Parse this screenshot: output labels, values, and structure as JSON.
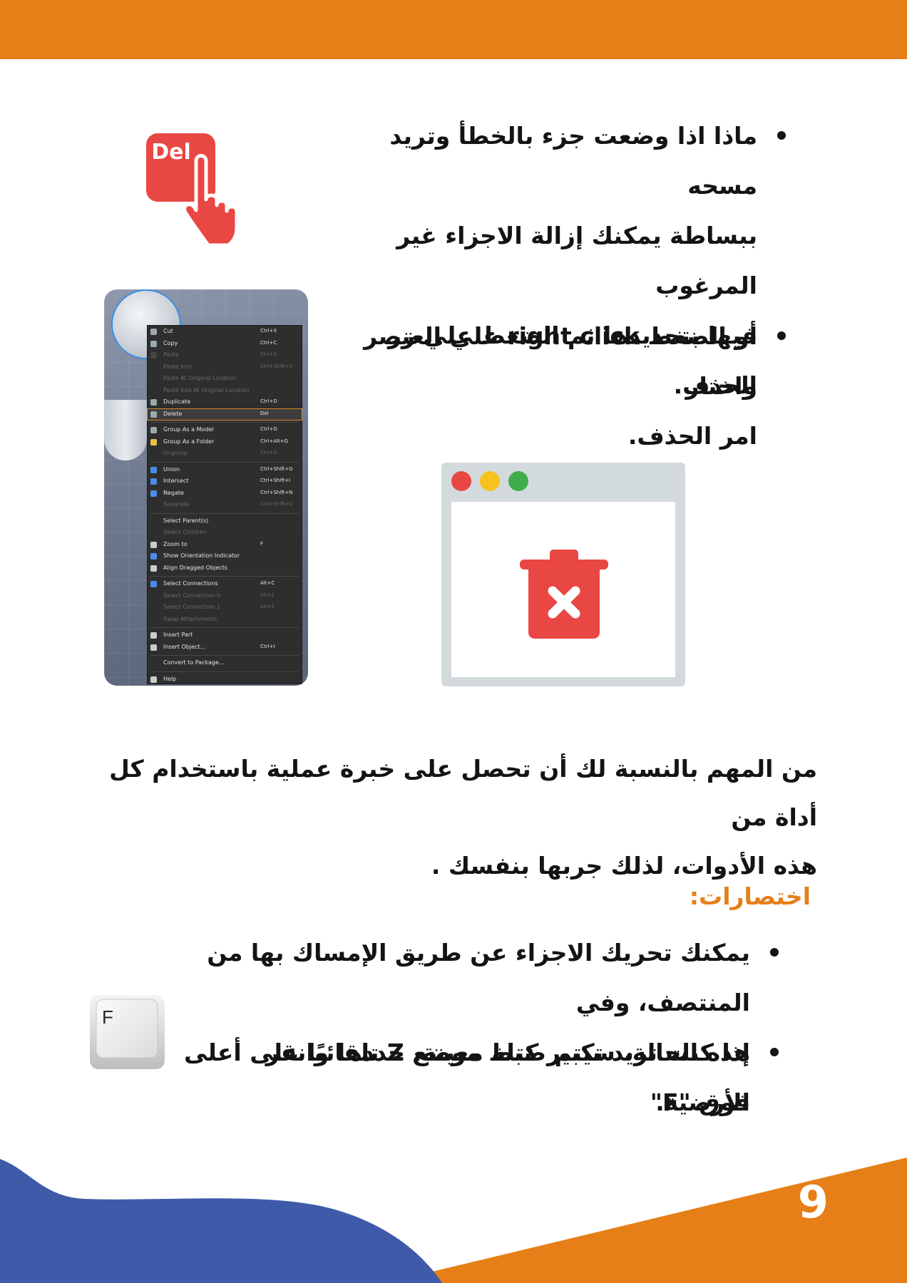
{
  "page": {
    "number": "9"
  },
  "colors": {
    "orange": "#e67f17",
    "blue": "#3f5aa9",
    "red": "#e94743",
    "panel": "#d3dade"
  },
  "section1": {
    "bullet1": [
      "ماذا اذا وضعت جزء بالخطأ وتريد مسحه",
      "ببساطة يمكنك إزالة الاجزاء غير المرغوب",
      "فيها بتحديدها ثم الضغط علي زر الحذف."
    ],
    "bullet2": [
      "أو الضغط right click علي العنصر واختار",
      "امر الحذف."
    ]
  },
  "del_icon": {
    "label": "Del",
    "icon": "hand-pointer-del-icon"
  },
  "window_icon": {
    "icon": "trash-x-icon",
    "dots": [
      "#e94743",
      "#f7c21c",
      "#3fae4a"
    ]
  },
  "context_menu": {
    "items": [
      {
        "label": "Cut",
        "shortcut": "Ctrl+X",
        "disabled": false,
        "icon": "cut-icon"
      },
      {
        "label": "Copy",
        "shortcut": "Ctrl+C",
        "disabled": false,
        "icon": "copy-icon"
      },
      {
        "label": "Paste",
        "shortcut": "Ctrl+V",
        "disabled": true,
        "icon": "paste-icon"
      },
      {
        "label": "Paste Into",
        "shortcut": "Ctrl+Shift+V",
        "disabled": true,
        "icon": ""
      },
      {
        "label": "Paste At Original Location",
        "shortcut": "",
        "disabled": true,
        "icon": ""
      },
      {
        "label": "Paste Into At Original Location",
        "shortcut": "",
        "disabled": true,
        "icon": ""
      },
      {
        "label": "Duplicate",
        "shortcut": "Ctrl+D",
        "disabled": false,
        "icon": "duplicate-icon"
      },
      {
        "label": "Delete",
        "shortcut": "Del",
        "disabled": false,
        "icon": "delete-icon",
        "highlight": true
      },
      {
        "label": "Group As a Model",
        "shortcut": "Ctrl+G",
        "disabled": false,
        "icon": "model-icon"
      },
      {
        "label": "Group As a Folder",
        "shortcut": "Ctrl+Alt+G",
        "disabled": false,
        "icon": "folder-icon"
      },
      {
        "label": "Ungroup",
        "shortcut": "Ctrl+U",
        "disabled": true,
        "icon": ""
      },
      {
        "label": "Union",
        "shortcut": "Ctrl+Shift+G",
        "disabled": false,
        "icon": "union-icon"
      },
      {
        "label": "Intersect",
        "shortcut": "Ctrl+Shift+I",
        "disabled": false,
        "icon": "intersect-icon"
      },
      {
        "label": "Negate",
        "shortcut": "Ctrl+Shift+N",
        "disabled": false,
        "icon": "negate-icon"
      },
      {
        "label": "Separate",
        "shortcut": "Ctrl+Shift+U",
        "disabled": true,
        "icon": ""
      },
      {
        "label": "Select Parent(s)",
        "shortcut": "",
        "disabled": false,
        "icon": ""
      },
      {
        "label": "Select Children",
        "shortcut": "",
        "disabled": true,
        "icon": ""
      },
      {
        "label": "Zoom to",
        "shortcut": "F",
        "disabled": false,
        "icon": "zoom-icon"
      },
      {
        "label": "Show Orientation Indicator",
        "shortcut": "",
        "disabled": false,
        "icon": "orientation-icon"
      },
      {
        "label": "Align Dragged Objects",
        "shortcut": "",
        "disabled": false,
        "icon": "check-icon"
      },
      {
        "label": "Select Connections",
        "shortcut": "Alt+C",
        "disabled": false,
        "icon": "connections-icon"
      },
      {
        "label": "Select Connection 0",
        "shortcut": "Alt+1",
        "disabled": true,
        "icon": ""
      },
      {
        "label": "Select Connection 1",
        "shortcut": "Alt+2",
        "disabled": true,
        "icon": ""
      },
      {
        "label": "Swap Attachments",
        "shortcut": "",
        "disabled": true,
        "icon": ""
      },
      {
        "label": "Insert Part",
        "shortcut": "",
        "disabled": false,
        "icon": "part-icon"
      },
      {
        "label": "Insert Object...",
        "shortcut": "Ctrl+I",
        "disabled": false,
        "icon": "object-icon"
      },
      {
        "label": "Convert to Package...",
        "shortcut": "",
        "disabled": false,
        "icon": ""
      },
      {
        "label": "Help",
        "shortcut": "",
        "disabled": false,
        "icon": "help-icon"
      }
    ]
  },
  "middle_paragraph": [
    "من المهم بالنسبة لك أن تحصل على خبرة عملية باستخدام كل أداة من",
    "هذه الأدوات، لذلك جربها بنفسك ."
  ],
  "shortcuts": {
    "title": "اختصارات:",
    "bullet1": [
      "يمكنك تحريك الاجزاء عن طريق الإمساك بها من المنتصف، وفي",
      "هذه الحالة، سيتم ضبط موضع Z تلقائيًا على أعلى الأرضية."
    ],
    "bullet2": [
      "إذا كنت تريد تكبير كتلة معينة، حددها وانقر فوق \"F\""
    ]
  },
  "f_key": {
    "label": "F"
  }
}
